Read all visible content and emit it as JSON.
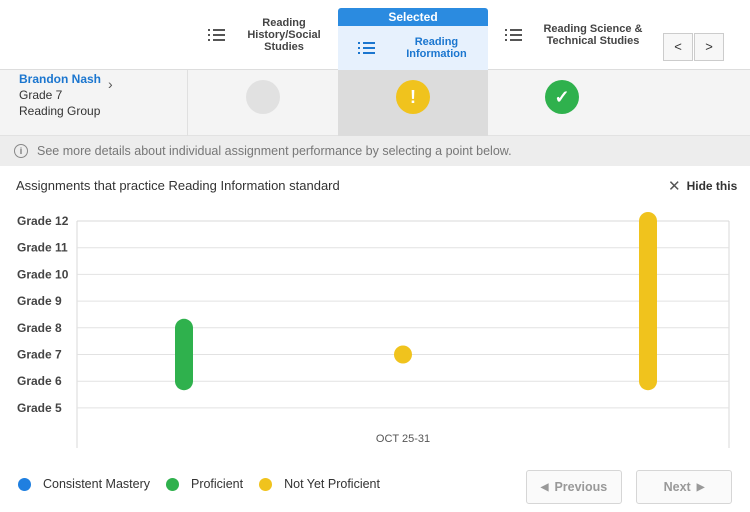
{
  "tabs": [
    {
      "label": "Reading History/Social Studies"
    },
    {
      "label": "Reading Information",
      "selected_banner": "Selected"
    },
    {
      "label": "Reading Science & Technical Studies"
    }
  ],
  "nav": {
    "prev_symbol": "<",
    "next_symbol": ">"
  },
  "student": {
    "name": "Brandon Nash",
    "grade": "Grade 7",
    "group": "Reading Group"
  },
  "status": {
    "history": "not-assessed",
    "information": {
      "state": "not-yet-proficient",
      "symbol": "!"
    },
    "science": {
      "state": "proficient",
      "symbol": "✓"
    }
  },
  "info_bar": {
    "icon": "i",
    "text": "See more details about individual assignment performance by selecting a point below."
  },
  "card": {
    "title": "Assignments that practice Reading Information standard",
    "hide_label": "Hide this",
    "close_symbol": "✕"
  },
  "colors": {
    "consistent_mastery": "#1f7fe0",
    "proficient": "#2fb14d",
    "not_yet_proficient": "#f0c31d",
    "selected": "#2b8be0",
    "link": "#1b76cf"
  },
  "chart_data": {
    "type": "scatter",
    "y_categories": [
      "Grade 5",
      "Grade 6",
      "Grade 7",
      "Grade 8",
      "Grade 9",
      "Grade 10",
      "Grade 11",
      "Grade 12"
    ],
    "x_label": "OCT 25-31",
    "grid": true,
    "series": [
      {
        "name": "Proficient",
        "color": "#2fb14d",
        "ranges": [
          {
            "x": 0.25,
            "from": 6,
            "to": 8
          }
        ]
      },
      {
        "name": "Not Yet Proficient",
        "color": "#f0c31d",
        "ranges": [
          {
            "x": 0.5,
            "from": 7,
            "to": 7
          },
          {
            "x": 0.75,
            "from": 6,
            "to": 12
          }
        ]
      }
    ]
  },
  "legend": [
    {
      "label": "Consistent Mastery",
      "color": "#1f7fe0"
    },
    {
      "label": "Proficient",
      "color": "#2fb14d"
    },
    {
      "label": "Not Yet Proficient",
      "color": "#f0c31d"
    }
  ],
  "pager": {
    "previous": "Previous",
    "next": "Next",
    "prev_arrow": "◀",
    "next_arrow": "▶"
  }
}
